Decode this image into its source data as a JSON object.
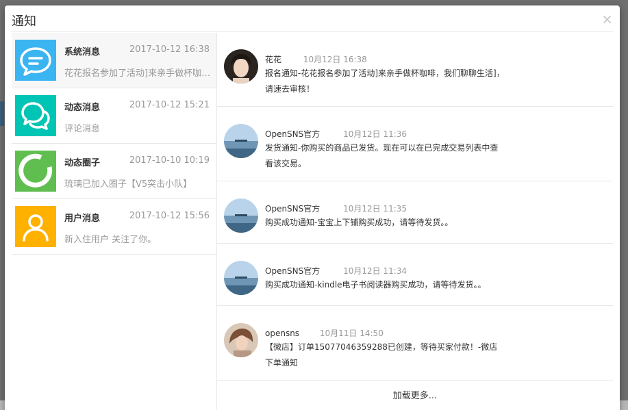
{
  "modal": {
    "title": "通知",
    "close_label": "×"
  },
  "categories": [
    {
      "name": "系统消息",
      "time": "2017-10-12 16:38",
      "preview": "花花报名参加了活动]来亲手做杯咖啡，我们聊聊生活]",
      "icon": "chat-bubble-icon",
      "color": "#3bb4f2"
    },
    {
      "name": "动态消息",
      "time": "2017-10-12 15:21",
      "preview": "评论消息",
      "icon": "comments-icon",
      "color": "#00c4b4"
    },
    {
      "name": "动态圈子",
      "time": "2017-10-10 10:19",
      "preview": "琉璃已加入圈子【V5突击小队】",
      "icon": "circle-ring-icon",
      "color": "#5fbe4f"
    },
    {
      "name": "用户消息",
      "time": "2017-10-12 15:56",
      "preview": "新入住用户 关注了你。",
      "icon": "user-icon",
      "color": "#ffb100"
    }
  ],
  "messages": [
    {
      "user": "花花",
      "time": "10月12日 16:38",
      "text": "报名通知-花花报名参加了活动]来亲手做杯咖啡，我们聊聊生活]，请速去审核！",
      "avatar": "girl-portrait-avatar"
    },
    {
      "user": "OpenSNS官方",
      "time": "10月12日 11:36",
      "text": "发货通知-你购买的商品已发货。现在可以在已完成交易列表中查看该交易。",
      "avatar": "lake-avatar"
    },
    {
      "user": "OpenSNS官方",
      "time": "10月12日 11:35",
      "text": "购买成功通知-宝宝上下铺购买成功，请等待发货。。",
      "avatar": "lake-avatar"
    },
    {
      "user": "OpenSNS官方",
      "time": "10月12日 11:34",
      "text": "购买成功通知-kindle电子书阅读器购买成功，请等待发货。。",
      "avatar": "lake-avatar"
    },
    {
      "user": "opensns",
      "time": "10月11日 14:50",
      "text": "【微店】订单15077046359288已创建，等待买家付款！-微店下单通知",
      "avatar": "woman-portrait-avatar"
    }
  ],
  "load_more": "加载更多..."
}
